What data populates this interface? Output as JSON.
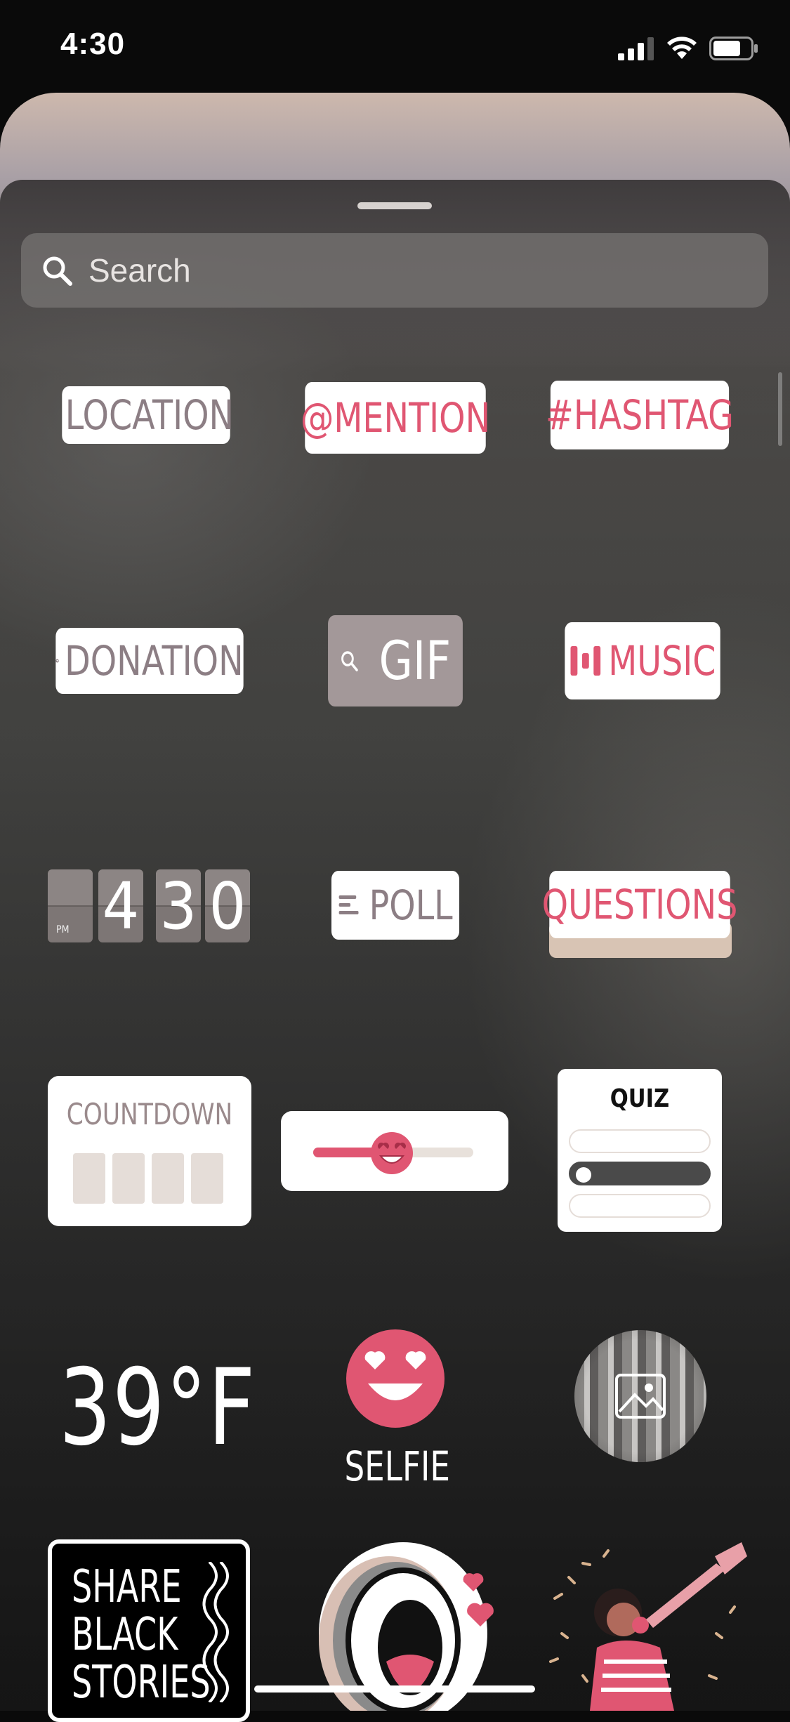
{
  "status_bar": {
    "time": "4:30"
  },
  "search": {
    "placeholder": "Search"
  },
  "stickers": {
    "location": "LOCATION",
    "mention": "@MENTION",
    "hashtag": "#HASHTAG",
    "donation": "DONATION",
    "gif": "GIF",
    "music": "MUSIC",
    "clock": {
      "period": "PM",
      "digits": [
        "4",
        "3",
        "0"
      ]
    },
    "poll": "POLL",
    "questions": "QUESTIONS",
    "countdown": "COUNTDOWN",
    "emoji_slider": {
      "value_fraction": 0.5
    },
    "quiz": "QUIZ",
    "temperature": "39°F",
    "selfie": "SELFIE",
    "share_black_stories": [
      "SHARE",
      "BLACK",
      "STORIES"
    ]
  },
  "colors": {
    "accent_pink": "#e05672",
    "label_grey": "#8c7e84"
  },
  "icons": [
    "search-icon",
    "location-pin-icon",
    "heart-icon",
    "music-bars-icon",
    "poll-lines-icon",
    "photo-icon",
    "heart-eyes-emoji-icon"
  ]
}
